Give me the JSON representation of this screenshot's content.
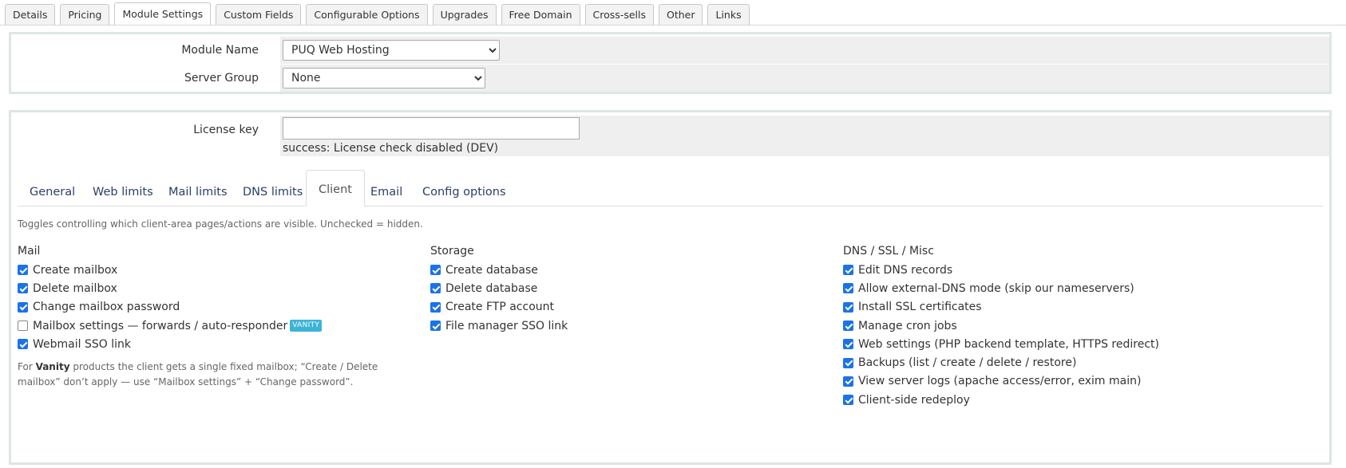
{
  "top_tabs": [
    {
      "label": "Details",
      "active": false
    },
    {
      "label": "Pricing",
      "active": false
    },
    {
      "label": "Module Settings",
      "active": true
    },
    {
      "label": "Custom Fields",
      "active": false
    },
    {
      "label": "Configurable Options",
      "active": false
    },
    {
      "label": "Upgrades",
      "active": false
    },
    {
      "label": "Free Domain",
      "active": false
    },
    {
      "label": "Cross-sells",
      "active": false
    },
    {
      "label": "Other",
      "active": false
    },
    {
      "label": "Links",
      "active": false
    }
  ],
  "module": {
    "module_name_label": "Module Name",
    "module_name_value": "PUQ Web Hosting",
    "server_group_label": "Server Group",
    "server_group_value": "None"
  },
  "license": {
    "label": "License key",
    "value": "",
    "status": "success: License check disabled (DEV)"
  },
  "inner_tabs": [
    {
      "label": "General",
      "active": false
    },
    {
      "label": "Web limits",
      "active": false
    },
    {
      "label": "Mail limits",
      "active": false
    },
    {
      "label": "DNS limits",
      "active": false
    },
    {
      "label": "Client",
      "active": true
    },
    {
      "label": "Email",
      "active": false
    },
    {
      "label": "Config options",
      "active": false
    }
  ],
  "hint": "Toggles controlling which client-area pages/actions are visible. Unchecked = hidden.",
  "mail": {
    "title": "Mail",
    "items": [
      {
        "label": "Create mailbox",
        "checked": true
      },
      {
        "label": "Delete mailbox",
        "checked": true
      },
      {
        "label": "Change mailbox password",
        "checked": true
      },
      {
        "label": "Mailbox settings — forwards / auto-responder",
        "checked": false,
        "badge": "VANITY"
      },
      {
        "label": "Webmail SSO link",
        "checked": true
      }
    ],
    "note_prefix": "For ",
    "note_bold": "Vanity",
    "note_suffix": " products the client gets a single fixed mailbox; “Create / Delete mailbox” don’t apply — use “Mailbox settings” + “Change password”."
  },
  "storage": {
    "title": "Storage",
    "items": [
      {
        "label": "Create database",
        "checked": true
      },
      {
        "label": "Delete database",
        "checked": true
      },
      {
        "label": "Create FTP account",
        "checked": true
      },
      {
        "label": "File manager SSO link",
        "checked": true
      }
    ]
  },
  "dns": {
    "title": "DNS / SSL / Misc",
    "items": [
      {
        "label": "Edit DNS records",
        "checked": true
      },
      {
        "label": "Allow external-DNS mode (skip our nameservers)",
        "checked": true
      },
      {
        "label": "Install SSL certificates",
        "checked": true
      },
      {
        "label": "Manage cron jobs",
        "checked": true
      },
      {
        "label": "Web settings (PHP backend template, HTTPS redirect)",
        "checked": true
      },
      {
        "label": "Backups (list / create / delete / restore)",
        "checked": true
      },
      {
        "label": "View server logs (apache access/error, exim main)",
        "checked": true
      },
      {
        "label": "Client-side redeploy",
        "checked": true
      }
    ]
  },
  "colors": {
    "accent": "#1a73e8",
    "badge": "#3bb4d8",
    "panel_border": "#dde6e3",
    "field_bg": "#efefef",
    "tab_text": "#2a3f66"
  }
}
